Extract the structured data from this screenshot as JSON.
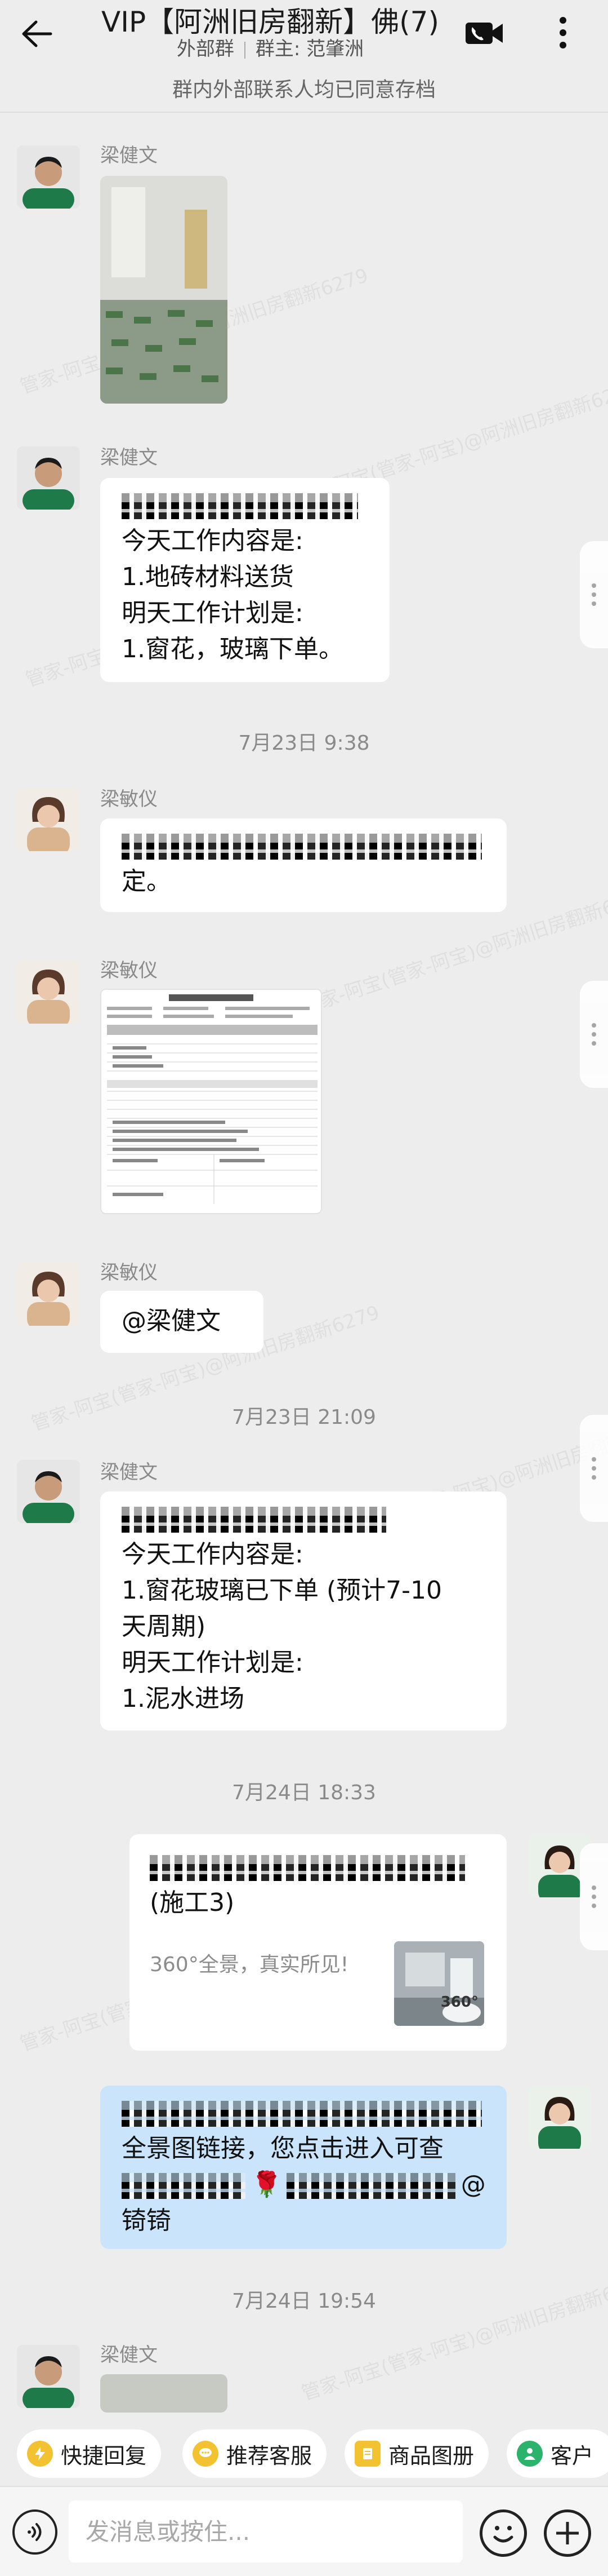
{
  "header": {
    "title": "VIP【阿洲旧房翻新】佛(7)",
    "subtitle_left": "外部群",
    "subtitle_right": "群主: 范肇洲",
    "notice": "群内外部联系人均已同意存档"
  },
  "watermark": "管家-阿宝(管家-阿宝)@阿洲旧房翻新6279",
  "messages": {
    "m1": {
      "sender": "梁健文"
    },
    "m2": {
      "sender": "梁健文",
      "lines": [
        "今天工作内容是:",
        "1.地砖材料送货",
        "明天工作计划是:",
        "1.窗花，玻璃下单。"
      ]
    },
    "ts1": "7月23日  9:38",
    "m3": {
      "sender": "梁敏仪",
      "line2": "定。"
    },
    "m4": {
      "sender": "梁敏仪"
    },
    "m5": {
      "sender": "梁敏仪",
      "text": "@梁健文"
    },
    "ts2": "7月23日  21:09",
    "m6": {
      "sender": "梁健文",
      "lines": [
        "今天工作内容是:",
        "1.窗花玻璃已下单 (预计7-10",
        "天周期)",
        "明天工作计划是:",
        "1.泥水进场"
      ]
    },
    "ts3": "7月24日  18:33",
    "m7": {
      "title_line2": "(施工3)",
      "desc": "360°全景，真实所见!",
      "thumb_badge": "360°"
    },
    "m8": {
      "line2": "全景图链接，您点击进入可查",
      "line3_tail": "@",
      "line4": "锜锜",
      "flower": "🌹"
    },
    "ts4": "7月24日  19:54",
    "m9": {
      "sender": "梁健文"
    }
  },
  "quick_actions": [
    "快捷回复",
    "推荐客服",
    "商品图册",
    "客户"
  ],
  "input": {
    "placeholder": "发消息或按住..."
  },
  "colors": {
    "bg": "#ededed",
    "bubble": "#ffffff",
    "self_bubble": "#c9e4fb",
    "accent": "#f3c230"
  }
}
